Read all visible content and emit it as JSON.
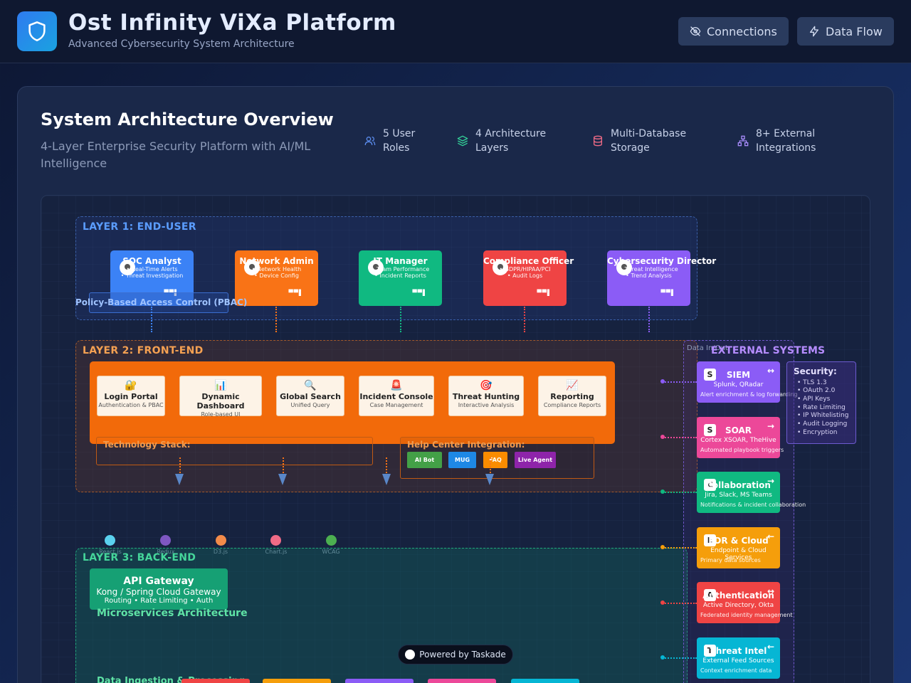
{
  "header": {
    "title": "Ost Infinity ViXa Platform",
    "subtitle": "Advanced Cybersecurity System Architecture",
    "buttons": {
      "connections": "Connections",
      "data_flow": "Data Flow"
    }
  },
  "overview": {
    "title": "System Architecture Overview",
    "subtitle": "4-Layer Enterprise Security Platform with AI/ML Intelligence",
    "stats": [
      {
        "icon": "users-icon",
        "label": "5 User Roles"
      },
      {
        "icon": "layers-icon",
        "label": "4 Architecture Layers"
      },
      {
        "icon": "database-icon",
        "label": "Multi-Database Storage"
      },
      {
        "icon": "network-icon",
        "label": "8+ External Integrations"
      }
    ]
  },
  "diagram": {
    "layer1": {
      "label": "LAYER 1: END-USER",
      "pbac": "Policy-Based Access Control (PBAC)",
      "roles": [
        {
          "name": "SOC Analyst",
          "line1": "• Real-Time Alerts",
          "line2": "• Threat Investigation",
          "color": "#3b82f6"
        },
        {
          "name": "Network Admin",
          "line1": "• Network Health",
          "line2": "• Device Config",
          "color": "#f97316"
        },
        {
          "name": "IT Manager",
          "line1": "• Team Performance",
          "line2": "• Incident Reports",
          "color": "#10b981"
        },
        {
          "name": "Compliance Officer",
          "line1": "• GDPR/HIPAA/PCI",
          "line2": "• Audit Logs",
          "color": "#ef4444"
        },
        {
          "name": "Cybersecurity Director",
          "line1": "• Threat Intelligence",
          "line2": "• Trend Analysis",
          "color": "#8b5cf6"
        }
      ]
    },
    "layer2": {
      "label": "LAYER 2: FRONT-END",
      "items": [
        {
          "icon": "🔐",
          "name": "Login Portal",
          "sub": "Authentication & PBAC"
        },
        {
          "icon": "📊",
          "name": "Dynamic Dashboard",
          "sub": "Role-based UI"
        },
        {
          "icon": "🔍",
          "name": "Global Search",
          "sub": "Unified Query"
        },
        {
          "icon": "🚨",
          "name": "Incident Console",
          "sub": "Case Management"
        },
        {
          "icon": "🎯",
          "name": "Threat Hunting",
          "sub": "Interactive Analysis"
        },
        {
          "icon": "📈",
          "name": "Reporting",
          "sub": "Compliance Reports"
        }
      ],
      "tech_label": "Technology Stack:",
      "tech": [
        {
          "name": "React.js",
          "color": "#5ad1ee"
        },
        {
          "name": "Redux",
          "color": "#7e57c2"
        },
        {
          "name": "D3.js",
          "color": "#f38b4a"
        },
        {
          "name": "Chart.js",
          "color": "#f06b86"
        },
        {
          "name": "WCAG",
          "color": "#4caf50"
        }
      ],
      "help_label": "Help Center Integration:",
      "help": [
        {
          "name": "AI Bot",
          "color": "#43a047"
        },
        {
          "name": "MUG",
          "color": "#1e88e5"
        },
        {
          "name": "FAQ",
          "color": "#fb8c00"
        },
        {
          "name": "Live Agent",
          "color": "#8e24aa"
        }
      ]
    },
    "layer3": {
      "label": "LAYER 3: BACK-END",
      "gateway": {
        "name": "API Gateway",
        "sub": "Kong / Spring Cloud Gateway",
        "sub2": "Routing • Rate Limiting • Auth"
      },
      "microservices": "Microservices Architecture",
      "ingestion": "Data Ingestion & Processing"
    },
    "external": {
      "hint": "Data In/Out",
      "label": "EXTERNAL SYSTEMS",
      "systems": [
        {
          "icon": "S",
          "name": "SIEM",
          "arrow": "↔",
          "sub": "Splunk, QRadar",
          "note": "Alert enrichment & log forwarding",
          "color": "#8b5cf6",
          "dot": "#8b5cf6"
        },
        {
          "icon": "S",
          "name": "SOAR",
          "arrow": "→",
          "sub": "Cortex XSOAR, TheHive",
          "note": "Automated playbook triggers",
          "color": "#ec4899",
          "dot": "#ec4899"
        },
        {
          "icon": "C",
          "name": "Collaboration",
          "arrow": "→",
          "sub": "Jira, Slack, MS Teams",
          "note": "Notifications & incident collaboration",
          "color": "#10b981",
          "dot": "#10b981"
        },
        {
          "icon": "E",
          "name": "EDR & Cloud",
          "arrow": "←",
          "sub": "Endpoint & Cloud Services",
          "note": "Primary data sources",
          "color": "#f59e0b",
          "dot": "#f59e0b"
        },
        {
          "icon": "A",
          "name": "Authentication",
          "arrow": "↔",
          "sub": "Active Directory, Okta",
          "note": "Federated identity management",
          "color": "#ef4444",
          "dot": "#ef4444"
        },
        {
          "icon": "T",
          "name": "Threat Intel",
          "arrow": "←",
          "sub": "External Feed Sources",
          "note": "Context enrichment data",
          "color": "#06b6d4",
          "dot": "#06b6d4"
        }
      ],
      "security_title": "Security:",
      "security_items": [
        "• TLS 1.3",
        "• OAuth 2.0",
        "• API Keys",
        "• Rate Limiting",
        "• IP Whitelisting",
        "• Audit Logging",
        "• Encryption"
      ]
    }
  },
  "footer": {
    "powered": "Powered by Taskade"
  }
}
